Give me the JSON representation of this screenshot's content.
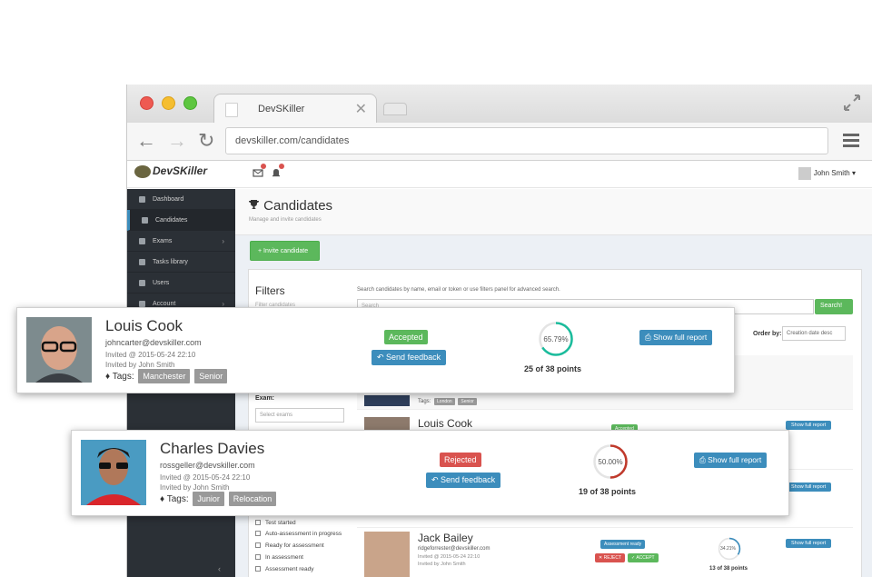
{
  "browser": {
    "tab_title": "DevSKiller",
    "tab_close": "✕",
    "url": "devskiller.com/candidates"
  },
  "app": {
    "logo_text": "DevSKiller",
    "user_name": "John Smith ▾"
  },
  "sidebar": {
    "items": [
      {
        "label": "Dashboard"
      },
      {
        "label": "Candidates"
      },
      {
        "label": "Exams",
        "arrow": "›"
      },
      {
        "label": "Tasks library"
      },
      {
        "label": "Users"
      },
      {
        "label": "Account",
        "arrow": "›"
      }
    ],
    "collapse": "‹"
  },
  "page": {
    "title": "Candidates",
    "subtitle": "Manage and invite candidates",
    "invite_button": "Invite candidate"
  },
  "filters": {
    "title": "Filters",
    "subtitle": "Filter candidates",
    "search_hint": "Search candidates by name, email or token or use filters panel for advanced search.",
    "search_placeholder": "Search",
    "search_button": "Search!",
    "order_label": "Order by:",
    "order_value": "Creation date desc",
    "exam_label": "Exam:",
    "exam_placeholder": "Select exams",
    "checkboxes": [
      "Test started",
      "Auto-assessment in progress",
      "Ready for assessment",
      "In assessment",
      "Assessment ready"
    ]
  },
  "list": {
    "row1_tags_label": "Tags:",
    "row1_tags": [
      "London",
      "Senior"
    ],
    "row2": {
      "name": "Louis Cook",
      "status": "Accepted",
      "report": "Show full report"
    },
    "row3": {
      "report": "Show full report"
    },
    "row4": {
      "name": "Jack Bailey",
      "email": "ridgeforrester@devskiller.com",
      "invited": "Invited @ 2015-05-24 22:10",
      "invited_by": "Invited by John Smith",
      "status": "Assessment ready",
      "reject": "REJECT",
      "accept": "ACCEPT",
      "score": "34.21%",
      "points": "13 of 38 points",
      "report": "Show full report",
      "score_fraction": 0.3421
    }
  },
  "cards": [
    {
      "name": "Louis Cook",
      "email": "johncarter@devskiller.com",
      "invited": "Invited @ 2015-05-24 22:10",
      "invited_by": "Invited by John Smith",
      "tags_label": "Tags:",
      "tags": [
        "Manchester",
        "Senior"
      ],
      "status": "Accepted",
      "status_color": "#5cb85c",
      "feedback": "Send feedback",
      "score": "65.79%",
      "score_fraction": 0.6579,
      "ring_color": "#1abc9c",
      "points": "25 of 38 points",
      "report": "Show full report"
    },
    {
      "name": "Charles Davies",
      "email": "rossgeller@devskiller.com",
      "invited": "Invited @ 2015-05-24 22:10",
      "invited_by": "Invited by John Smith",
      "tags_label": "Tags:",
      "tags": [
        "Junior",
        "Relocation"
      ],
      "status": "Rejected",
      "status_color": "#d9534f",
      "feedback": "Send feedback",
      "score": "50.00%",
      "score_fraction": 0.5,
      "ring_color": "#c0392b",
      "points": "19 of 38 points",
      "report": "Show full report"
    }
  ]
}
